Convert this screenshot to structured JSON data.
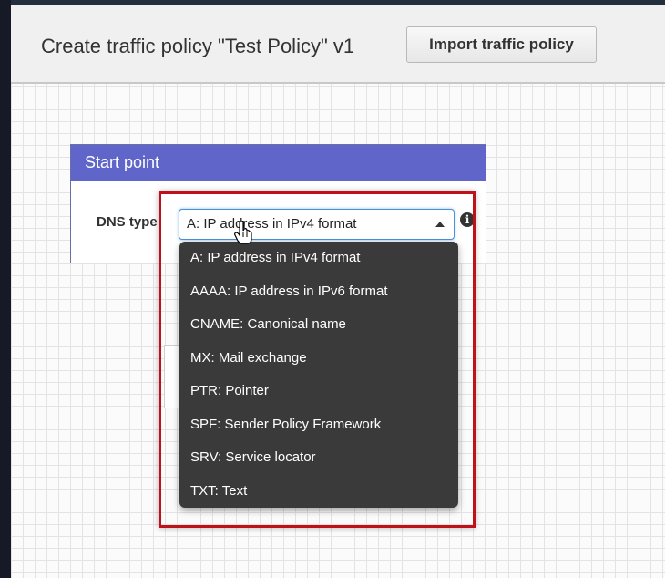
{
  "header": {
    "title": "Create traffic policy \"Test Policy\" v1",
    "import_button": "Import traffic policy"
  },
  "panel": {
    "title": "Start point",
    "dns_label": "DNS type",
    "selected_value": "A: IP address in IPv4 format",
    "info_glyph": "i"
  },
  "dropdown": {
    "options": [
      "A: IP address in IPv4 format",
      "AAAA: IP address in IPv6 format",
      "CNAME: Canonical name",
      "MX: Mail exchange",
      "PTR: Pointer",
      "SPF: Sender Policy Framework",
      "SRV: Service locator",
      "TXT: Text"
    ]
  },
  "colors": {
    "panel_header": "#5f65c9",
    "dropdown_bg": "#3a3a3a",
    "highlight_border": "#c0101a",
    "select_focus": "#4a90d9"
  }
}
